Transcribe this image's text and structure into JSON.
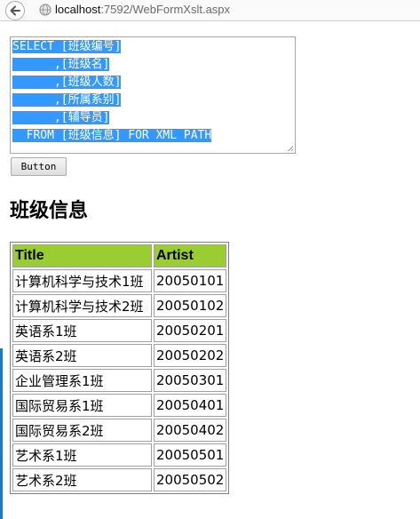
{
  "browser": {
    "url_host": "localhost",
    "url_path": ":7592/WebFormXslt.aspx"
  },
  "sql_text": [
    "SELECT [班级编号]",
    "      ,[班级名]",
    "      ,[班级人数]",
    "      ,[所属系别]",
    "      ,[辅导员]",
    "  FROM [班级信息] FOR XML PATH"
  ],
  "button_label": "Button",
  "heading": "班级信息",
  "table": {
    "headers": [
      "Title",
      "Artist"
    ],
    "rows": [
      [
        "计算机科学与技术1班",
        "20050101"
      ],
      [
        "计算机科学与技术2班",
        "20050102"
      ],
      [
        "英语系1班",
        "20050201"
      ],
      [
        "英语系2班",
        "20050202"
      ],
      [
        "企业管理系1班",
        "20050301"
      ],
      [
        "国际贸易系1班",
        "20050401"
      ],
      [
        "国际贸易系2班",
        "20050402"
      ],
      [
        "艺术系1班",
        "20050501"
      ],
      [
        "艺术系2班",
        "20050502"
      ]
    ]
  },
  "colors": {
    "header_bg": "#9acd32",
    "selection_bg": "#3399ff"
  },
  "icons": {
    "back": "back-arrow-icon",
    "site": "globe-icon"
  }
}
